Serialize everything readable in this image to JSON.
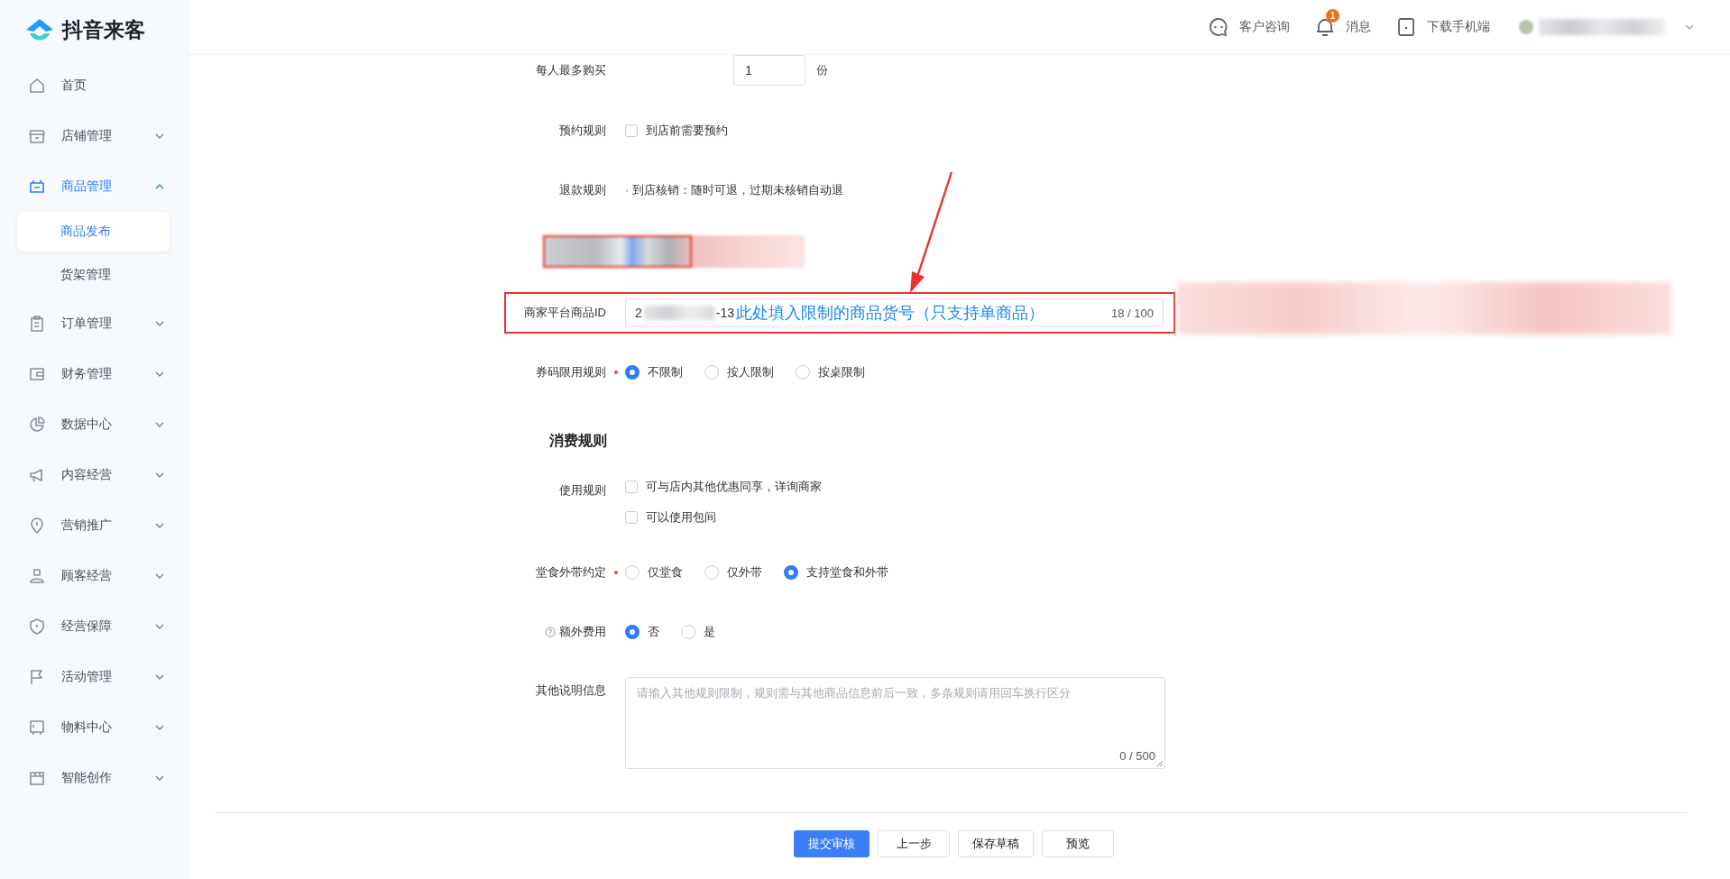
{
  "brand": "抖音来客",
  "header": {
    "actions": [
      {
        "kind": "chat",
        "label": "客户咨询"
      },
      {
        "kind": "bell",
        "label": "消息",
        "badge": "1"
      },
      {
        "kind": "phone",
        "label": "下载手机端"
      }
    ]
  },
  "nav": [
    {
      "kind": "link",
      "label": "首页"
    },
    {
      "kind": "group",
      "label": "店铺管理",
      "expanded": false
    },
    {
      "kind": "group",
      "label": "商品管理",
      "expanded": true,
      "children": [
        {
          "label": "商品发布",
          "selected": true
        },
        {
          "label": "货架管理",
          "selected": false
        }
      ]
    },
    {
      "kind": "group",
      "label": "订单管理",
      "expanded": false
    },
    {
      "kind": "group",
      "label": "财务管理",
      "expanded": false
    },
    {
      "kind": "group",
      "label": "数据中心",
      "expanded": false
    },
    {
      "kind": "group",
      "label": "内容经营",
      "expanded": false
    },
    {
      "kind": "group",
      "label": "营销推广",
      "expanded": false
    },
    {
      "kind": "group",
      "label": "顾客经营",
      "expanded": false
    },
    {
      "kind": "group",
      "label": "经营保障",
      "expanded": false
    },
    {
      "kind": "group",
      "label": "活动管理",
      "expanded": false
    },
    {
      "kind": "group",
      "label": "物料中心",
      "expanded": false
    },
    {
      "kind": "group",
      "label": "智能创作",
      "expanded": false
    }
  ],
  "form": [
    {
      "kind": "number",
      "label": "每人最多购买",
      "value": "1",
      "unit": "份"
    },
    {
      "kind": "checks",
      "label": "预约规则",
      "options": [
        {
          "label": "到店前需要预约",
          "checked": false
        }
      ]
    },
    {
      "kind": "text",
      "label": "退款规则",
      "text": "· 到店核销：随时可退，过期未核销自动退"
    },
    {
      "kind": "redacted"
    },
    {
      "kind": "id_input",
      "label": "商家平台商品ID",
      "value_start": "2",
      "value_end": "-13",
      "annotation": "此处填入限制的商品货号（只支持单商品）",
      "counter": "18 / 100"
    },
    {
      "kind": "radios",
      "label": "券码限用规则",
      "required": true,
      "help": false,
      "options": [
        {
          "label": "不限制",
          "selected": true
        },
        {
          "label": "按人限制",
          "selected": false
        },
        {
          "label": "按桌限制",
          "selected": false
        }
      ]
    },
    {
      "kind": "section",
      "title": "消费规则"
    },
    {
      "kind": "checks",
      "label": "使用规则",
      "options": [
        {
          "label": "可与店内其他优惠同享，详询商家",
          "checked": false
        },
        {
          "label": "可以使用包间",
          "checked": false
        }
      ]
    },
    {
      "kind": "radios",
      "label": "堂食外带约定",
      "required": true,
      "help": false,
      "options": [
        {
          "label": "仅堂食",
          "selected": false
        },
        {
          "label": "仅外带",
          "selected": false
        },
        {
          "label": "支持堂食和外带",
          "selected": true
        }
      ]
    },
    {
      "kind": "radios",
      "label": "额外费用",
      "required": false,
      "help": true,
      "options": [
        {
          "label": "否",
          "selected": true
        },
        {
          "label": "是",
          "selected": false
        }
      ]
    },
    {
      "kind": "textarea",
      "label": "其他说明信息",
      "placeholder": "请输入其他规则限制，规则需与其他商品信息前后一致，多条规则请用回车换行区分",
      "counter": "0 / 500"
    }
  ],
  "buttons": [
    {
      "label": "提交审核",
      "primary": true
    },
    {
      "label": "上一步",
      "primary": false
    },
    {
      "label": "保存草稿",
      "primary": false
    },
    {
      "label": "预览",
      "primary": false
    }
  ]
}
